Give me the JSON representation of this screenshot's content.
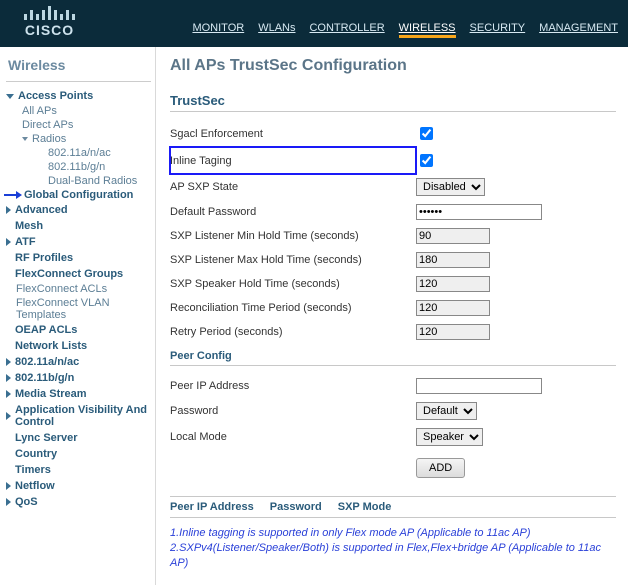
{
  "brand": "CISCO",
  "nav": {
    "monitor": "MONITOR",
    "wlans": "WLANs",
    "controller": "CONTROLLER",
    "wireless": "WIRELESS",
    "security": "SECURITY",
    "management": "MANAGEMENT"
  },
  "sidebar": {
    "title": "Wireless",
    "access_points": "Access Points",
    "all_aps": "All APs",
    "direct_aps": "Direct APs",
    "radios": "Radios",
    "radio_a": "802.11a/n/ac",
    "radio_b": "802.11b/g/n",
    "radio_dual": "Dual-Band Radios",
    "global_config": "Global Configuration",
    "advanced": "Advanced",
    "mesh": "Mesh",
    "atf": "ATF",
    "rf_profiles": "RF Profiles",
    "flex_groups": "FlexConnect Groups",
    "flex_acls": "FlexConnect ACLs",
    "flex_vlan": "FlexConnect VLAN Templates",
    "oeap_acls": "OEAP ACLs",
    "network_lists": "Network Lists",
    "s_80211a": "802.11a/n/ac",
    "s_80211b": "802.11b/g/n",
    "media_stream": "Media Stream",
    "app_vis": "Application Visibility And Control",
    "lync": "Lync Server",
    "country": "Country",
    "timers": "Timers",
    "netflow": "Netflow",
    "qos": "QoS"
  },
  "page": {
    "title": "All APs TrustSec Configuration",
    "section": "TrustSec",
    "peer_section": "Peer Config",
    "sgacl_label": "Sgacl Enforcement",
    "inline_label": "Inline Taging",
    "ap_sxp_label": "AP SXP State",
    "ap_sxp_value": "Disabled",
    "def_pw_label": "Default Password",
    "def_pw_value": "••••••",
    "sxp_min_label": "SXP Listener Min Hold Time (seconds)",
    "sxp_min_value": "90",
    "sxp_max_label": "SXP Listener Max Hold Time (seconds)",
    "sxp_max_value": "180",
    "sxp_speaker_label": "SXP Speaker Hold Time (seconds)",
    "sxp_speaker_value": "120",
    "recon_label": "Reconciliation Time Period (seconds)",
    "recon_value": "120",
    "retry_label": "Retry Period (seconds)",
    "retry_value": "120",
    "peer_ip_label": "Peer IP Address",
    "peer_pw_label": "Password",
    "peer_pw_value": "Default",
    "local_mode_label": "Local Mode",
    "local_mode_value": "Speaker",
    "add_label": "ADD",
    "col_peer": "Peer IP Address",
    "col_pw": "Password",
    "col_mode": "SXP Mode",
    "note1": "1.Inline tagging is supported in only Flex mode AP (Applicable to 11ac AP)",
    "note2": "2.SXPv4(Listener/Speaker/Both) is supported in Flex,Flex+bridge AP (Applicable to 11ac AP)"
  }
}
